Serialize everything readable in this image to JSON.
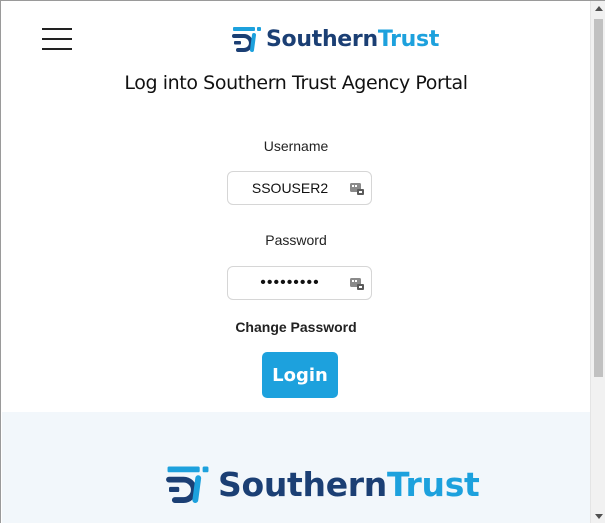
{
  "header": {
    "logo": {
      "part1": "Southern",
      "part2": "Trust"
    },
    "title": "Log into Southern Trust Agency Portal"
  },
  "form": {
    "username_label": "Username",
    "username_value": "SSOUSER2",
    "password_label": "Password",
    "password_value": "•••••••••",
    "change_password": "Change Password",
    "login_label": "Login"
  },
  "footer": {
    "logo": {
      "part1": "Southern",
      "part2": "Trust"
    }
  },
  "colors": {
    "brand_navy": "#1b3f74",
    "brand_blue": "#1da1dd",
    "footer_bg": "#f2f7fb"
  },
  "icons": [
    "menu-icon",
    "southern-trust-logo-icon",
    "password-manager-key-icon"
  ]
}
